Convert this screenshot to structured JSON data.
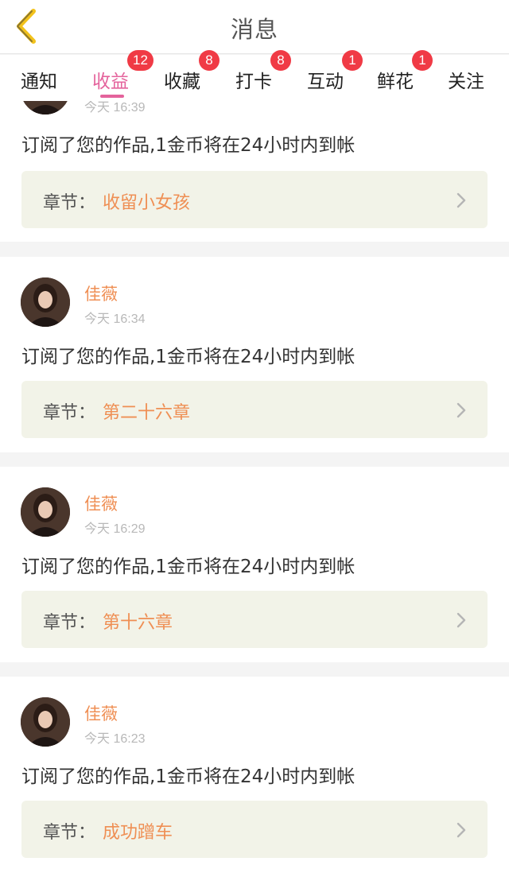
{
  "header": {
    "title": "消息",
    "back_icon": "chevron-left-icon"
  },
  "tabs": [
    {
      "label": "通知",
      "badge": "",
      "active": false
    },
    {
      "label": "收益",
      "badge": "12",
      "active": true
    },
    {
      "label": "收藏",
      "badge": "8",
      "active": false
    },
    {
      "label": "打卡",
      "badge": "8",
      "active": false
    },
    {
      "label": "互动",
      "badge": "1",
      "active": false
    },
    {
      "label": "鲜花",
      "badge": "1",
      "active": false
    },
    {
      "label": "关注",
      "badge": "",
      "active": false
    }
  ],
  "messages": [
    {
      "user": "",
      "time": "今天 16:39",
      "text": "订阅了您的作品,1金币将在24小时内到帐",
      "chapter_label": "章节：",
      "chapter_name": "收留小女孩"
    },
    {
      "user": "佳薇",
      "time": "今天 16:34",
      "text": "订阅了您的作品,1金币将在24小时内到帐",
      "chapter_label": "章节：",
      "chapter_name": "第二十六章"
    },
    {
      "user": "佳薇",
      "time": "今天 16:29",
      "text": "订阅了您的作品,1金币将在24小时内到帐",
      "chapter_label": "章节：",
      "chapter_name": "第十六章"
    },
    {
      "user": "佳薇",
      "time": "今天 16:23",
      "text": "订阅了您的作品,1金币将在24小时内到帐",
      "chapter_label": "章节：",
      "chapter_name": "成功蹭车"
    }
  ],
  "colors": {
    "accent": "#e4639c",
    "badge": "#f03a45",
    "name": "#ef8f54",
    "chapter_bg": "#f2f3e8",
    "back_arrow": "#f2c21b"
  }
}
